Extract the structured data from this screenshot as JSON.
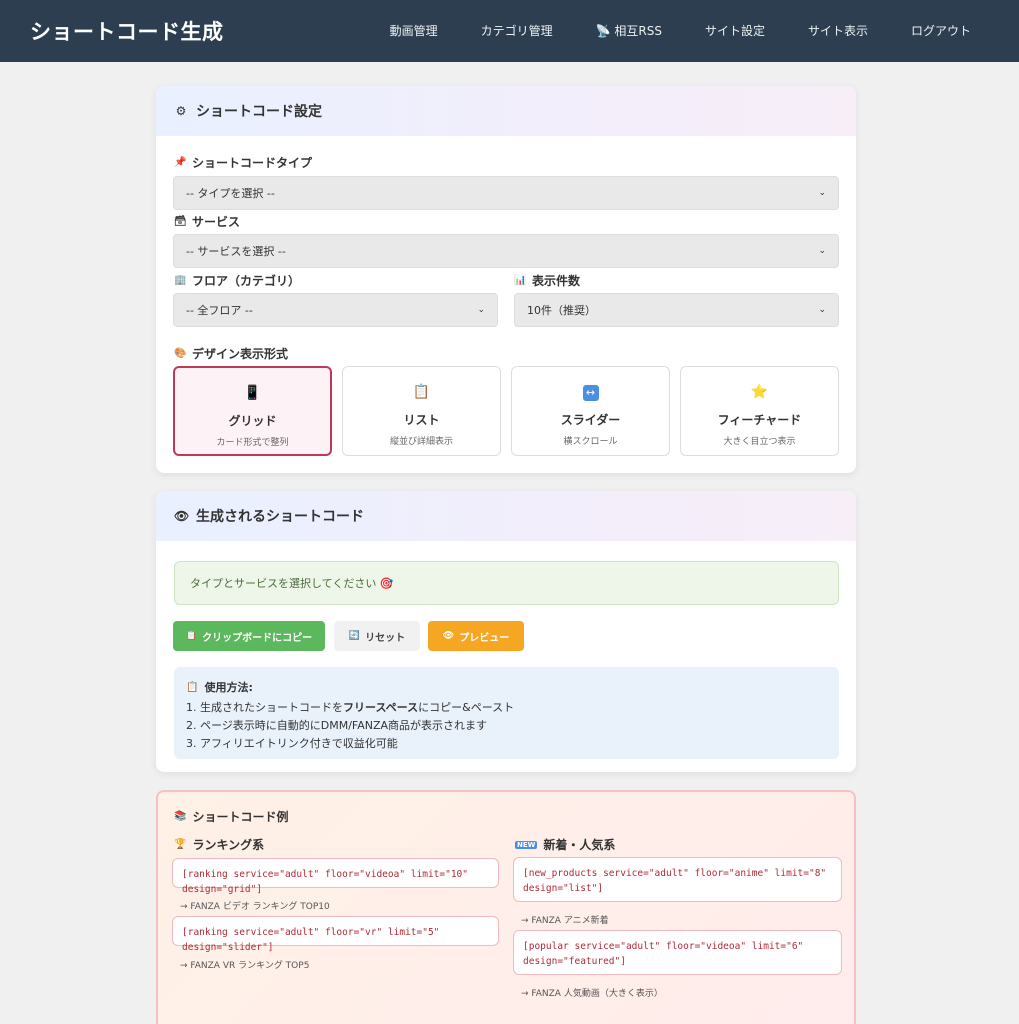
{
  "header": {
    "brand": "ショートコード生成",
    "nav": [
      "動画管理",
      "カテゴリ管理",
      "📡 相互RSS",
      "サイト設定",
      "サイト表示",
      "ログアウト"
    ]
  },
  "settings": {
    "title": "ショートコード設定",
    "type_label": "ショートコードタイプ",
    "type_value": "-- タイプを選択 --",
    "service_label": "サービス",
    "service_value": "-- サービスを選択 --",
    "floor_label": "フロア（カテゴリ）",
    "floor_value": "-- 全フロア --",
    "count_label": "表示件数",
    "count_value": "10件（推奨）",
    "design_label": "デザイン表示形式",
    "designs": [
      {
        "title": "グリッド",
        "sub": "カード形式で整列",
        "icon": "📱"
      },
      {
        "title": "リスト",
        "sub": "縦並び詳細表示",
        "icon": "📋"
      },
      {
        "title": "スライダー",
        "sub": "横スクロール",
        "icon": "↔"
      },
      {
        "title": "フィーチャード",
        "sub": "大きく目立つ表示",
        "icon": "⭐"
      }
    ]
  },
  "generated": {
    "title": "生成されるショートコード",
    "notice": "タイプとサービスを選択してください 🎯",
    "copy": "クリップボードにコピー",
    "reset": "リセット",
    "preview": "プレビュー",
    "usage_title": "使用方法:",
    "usage1_pre": "1. 生成されたショートコードを",
    "usage1_bold": "フリースペース",
    "usage1_post": "にコピー&ペースト",
    "usage2": "2. ページ表示時に自動的にDMM/FANZA商品が表示されます",
    "usage3": "3. アフィリエイトリンク付きで収益化可能"
  },
  "examples": {
    "title": "ショートコード例",
    "ranking_title": "ランキング系",
    "new_title": "新着・人気系",
    "r1": "[ranking service=\"adult\" floor=\"videoa\" limit=\"10\" design=\"grid\"]",
    "r1_desc": "→ FANZA ビデオ ランキング TOP10",
    "r2": "[ranking service=\"adult\" floor=\"vr\" limit=\"5\" design=\"slider\"]",
    "r2_desc": "→ FANZA VR ランキング TOP5",
    "n1a": "[new_products service=\"adult\" floor=\"anime\" limit=\"8\"",
    "n1b": "design=\"list\"]",
    "n1_desc": "→ FANZA アニメ新着",
    "n2a": "[popular service=\"adult\" floor=\"videoa\" limit=\"6\"",
    "n2b": "design=\"featured\"]",
    "n2_desc": "→ FANZA 人気動画（大きく表示）"
  },
  "icons": {
    "settings": "gear-icon",
    "eye": "eye-icon"
  }
}
